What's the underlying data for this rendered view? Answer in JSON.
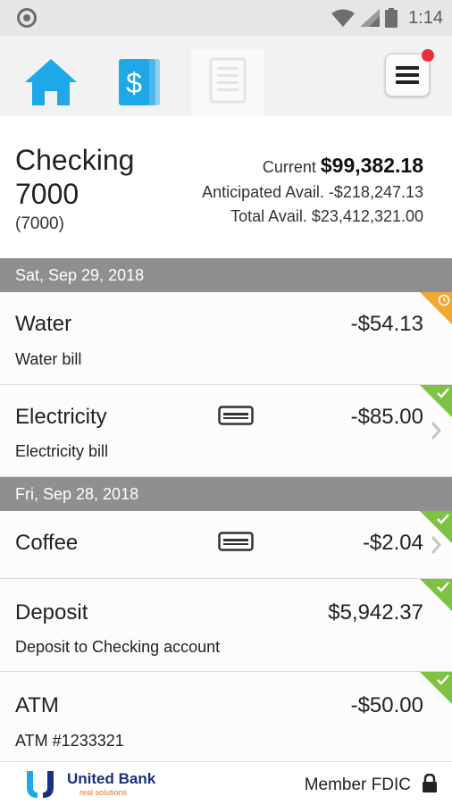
{
  "status_bar": {
    "time": "1:14"
  },
  "nav": {
    "items": [
      {
        "icon": "home-icon"
      },
      {
        "icon": "dollar-cards-icon"
      },
      {
        "icon": "document-icon"
      }
    ],
    "menu_icon": "hamburger-menu-icon"
  },
  "account": {
    "name": "Checking 7000",
    "number": "(7000)",
    "current_label": "Current",
    "current_value": "$99,382.18",
    "anticipated_label": "Anticipated Avail.",
    "anticipated_value": "-$218,247.13",
    "total_label": "Total Avail.",
    "total_value": "$23,412,321.00"
  },
  "groups": [
    {
      "date": "Sat, Sep 29, 2018",
      "transactions": [
        {
          "title": "Water",
          "description": "Water bill",
          "amount": "-$54.13",
          "status": "pending"
        },
        {
          "title": "Electricity",
          "description": "Electricity bill",
          "amount": "-$85.00",
          "status": "cleared"
        }
      ]
    },
    {
      "date": "Fri, Sep 28, 2018",
      "transactions": [
        {
          "title": "Coffee",
          "description": "",
          "amount": "-$2.04",
          "status": "cleared"
        },
        {
          "title": "Deposit",
          "description": "Deposit to Checking account",
          "amount": "$5,942.37",
          "status": "cleared"
        },
        {
          "title": "ATM",
          "description": "ATM #1233321",
          "amount": "-$50.00",
          "status": "cleared"
        }
      ]
    }
  ],
  "footer": {
    "bank_name": "United Bank",
    "tagline": "real solutions",
    "member": "Member FDIC"
  },
  "colors": {
    "accent_blue": "#1ea8e8",
    "cleared_green": "#7cc243",
    "pending_orange": "#f0a830",
    "date_header_gray": "#8f8f8f"
  }
}
